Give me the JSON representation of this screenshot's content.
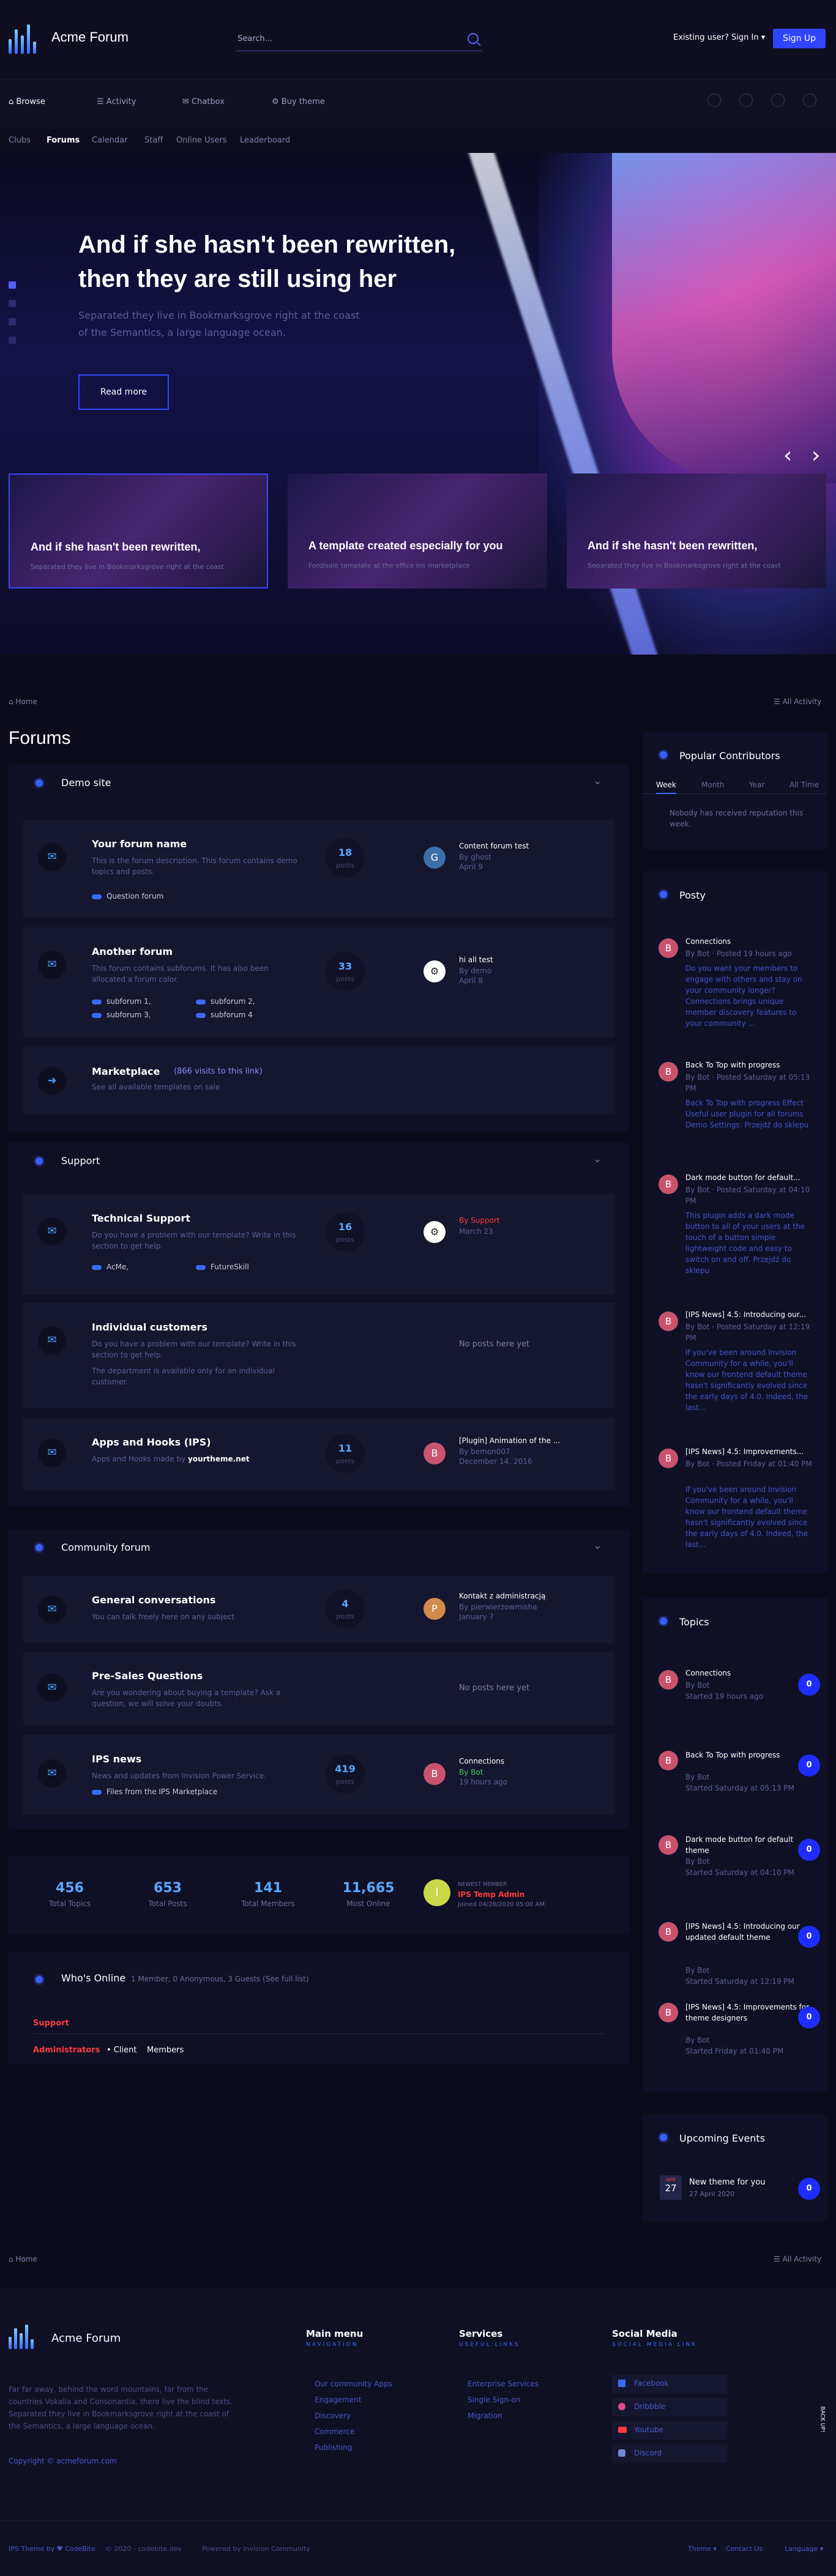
{
  "header": {
    "title": "Acme Forum",
    "search_placeholder": "Search...",
    "signin": "Existing user? Sign In ▾",
    "signup": "Sign Up"
  },
  "nav": {
    "items": [
      "Browse",
      "Activity",
      "Chatbox",
      "Buy theme"
    ]
  },
  "subnav": {
    "items": [
      "Clubs",
      "Forums",
      "Calendar",
      "Staff",
      "Online Users",
      "Leaderboard"
    ]
  },
  "hero": {
    "title": "And if she hasn't been rewritten, then they are still using her",
    "desc": "Separated they live in Bookmarksgrove right at the coast of the Semantics, a large language ocean.",
    "button": "Read more",
    "cards": [
      {
        "title": "And if she hasn't been rewritten,",
        "desc": "Separated they live in Bookmarksgrove right at the coast"
      },
      {
        "title": "A template created especially for you",
        "desc": "Fordisole template at the office ins marketplace"
      },
      {
        "title": "And if she hasn't been rewritten,",
        "desc": "Separated they live in Bookmarksgrove right at the coast"
      }
    ]
  },
  "breadcrumb": {
    "home": "Home",
    "all_activity": "All Activity"
  },
  "page_title": "Forums",
  "categories": [
    {
      "title": "Demo site",
      "forums": [
        {
          "name": "Your forum name",
          "desc": "This is the forum description. This forum contains demo topics and posts.",
          "sub": [
            "Question forum"
          ],
          "count": "18",
          "count_label": "posts",
          "av": "G",
          "av_color": "#3d6fa8",
          "lp_title": "Content forum test",
          "lp_by": "By ghost",
          "lp_date": "April 9"
        },
        {
          "name": "Another forum",
          "desc": "This forum contains subforums. It has also been allocated a forum color.",
          "sub": [
            "subforum 1,",
            "subforum 2,",
            "subforum 3,",
            "subforum 4"
          ],
          "count": "33",
          "count_label": "posts",
          "av": "⚙",
          "av_color": "#ffffff",
          "lp_title": "hi all test",
          "lp_by": "By demo",
          "lp_date": "April 8"
        },
        {
          "name": "Marketplace",
          "name_extra": "(866 visits to this link)",
          "desc": "See all available templates on sale"
        }
      ]
    },
    {
      "title": "Support",
      "forums": [
        {
          "name": "Technical Support",
          "desc": "Do you have a problem with our template? Write in this section to get help.",
          "sub": [
            "AcMe,",
            "FutureSkill"
          ],
          "count": "16",
          "count_label": "posts",
          "av": "⚙",
          "av_color": "#ffffff",
          "lp_title": "By Support",
          "lp_by": "",
          "lp_date": "March 23"
        },
        {
          "name": "Individual customers",
          "desc": "Do you have a problem with our template? Write in this section to get help.",
          "desc2": "The department is available only for an individual customer.",
          "nopost": "No posts here yet"
        },
        {
          "name": "Apps and Hooks (IPS)",
          "desc": "Apps and Hooks made by",
          "desc_link": "yourtheme.net",
          "count": "11",
          "count_label": "posts",
          "av": "B",
          "av_color": "#c8536e",
          "lp_title": "[Plugin] Animation of the ...",
          "lp_by": "By bemon007",
          "lp_date": "December 14, 2016"
        }
      ]
    },
    {
      "title": "Community forum",
      "forums": [
        {
          "name": "General conversations",
          "desc": "You can talk freely here on any subject",
          "count": "4",
          "count_label": "posts",
          "av": "P",
          "av_color": "#d08a4a",
          "lp_title": "Kontakt z administracją",
          "lp_by": "By pierwierzowmisha",
          "lp_date": "January 7"
        },
        {
          "name": "Pre-Sales Questions",
          "desc": "Are you wondering about buying a template? Ask a question, we will solve your doubts.",
          "nopost": "No posts here yet"
        },
        {
          "name": "IPS news",
          "desc": "News and updates from Invision Power Service.",
          "sub": [
            "Files from the IPS Marketplace"
          ],
          "count": "419",
          "count_label": "posts",
          "av": "B",
          "av_color": "#c8536e",
          "lp_title": "Connections",
          "lp_by": "By Bot",
          "lp_date": "19 hours ago"
        }
      ]
    }
  ],
  "stats": [
    {
      "n": "456",
      "l": "Total Topics"
    },
    {
      "n": "653",
      "l": "Total Posts"
    },
    {
      "n": "141",
      "l": "Total Members"
    },
    {
      "n": "11,665",
      "l": "Most Online"
    }
  ],
  "newest": {
    "label": "NEWEST MEMBER",
    "name": "IPS Temp Admin",
    "joined": "Joined 04/28/2020 05:00 AM",
    "av": "I"
  },
  "online": {
    "title": "Who's Online",
    "summary": "1 Member, 0 Anonymous, 3 Guests (See full list)",
    "member": "Support",
    "legend": [
      "Administrators",
      "• Client",
      "Members"
    ]
  },
  "sidebar": {
    "contributors": {
      "title": "Popular Contributors",
      "tabs": [
        "Week",
        "Month",
        "Year",
        "All Time"
      ],
      "empty": "Nobody has received reputation this week."
    },
    "posts": {
      "title": "Posty",
      "items": [
        {
          "t": "Connections",
          "m": "By Bot · Posted 19 hours ago",
          "b": "Do you want your members to engage with others and stay on your community longer? Connections brings unique member discovery features to your community ..."
        },
        {
          "t": "Back To Top with progress",
          "m": "By Bot · Posted Saturday at 05:13 PM",
          "b": "Back To Top with progress Effect Useful user plugin for all forums Demo Settings: Przejdź do sklepu"
        },
        {
          "t": "Dark mode button for default...",
          "m": "By Bot · Posted Saturday at 04:10 PM",
          "b": "This plugin adds a dark mode button to all of your users at the touch of a button simple lightweight code and easy to switch on and off. Przejdź do sklepu"
        },
        {
          "t": "[IPS News] 4.5: Introducing our...",
          "m": "By Bot · Posted Saturday at 12:19 PM",
          "b": "If you've been around Invision Community for a while, you'll know our frontend default theme hasn't significantly evolved since the early days of 4.0. Indeed, the last..."
        },
        {
          "t": "[IPS News] 4.5: Improvements...",
          "m": "By Bot · Posted Friday at 01:40 PM",
          "b": "If you've been around Invision Community for a while, you'll know our frontend default theme hasn't significantly evolved since the early days of 4.0. Indeed, the last..."
        }
      ]
    },
    "topics": {
      "title": "Topics",
      "items": [
        {
          "t": "Connections",
          "by": "By Bot",
          "s": "Started 19 hours ago",
          "c": "0"
        },
        {
          "t": "Back To Top with progress",
          "by": "By Bot",
          "s": "Started Saturday at 05:13 PM",
          "c": "0"
        },
        {
          "t": "Dark mode button for default theme",
          "by": "By Bot",
          "s": "Started Saturday at 04:10 PM",
          "c": "0"
        },
        {
          "t": "[IPS News] 4.5: Introducing our updated default theme",
          "by": "By Bot",
          "s": "Started Saturday at 12:19 PM",
          "c": "0"
        },
        {
          "t": "[IPS News] 4.5: Improvements for theme designers",
          "by": "By Bot",
          "s": "Started Friday at 01:40 PM",
          "c": "0"
        }
      ]
    },
    "events": {
      "title": "Upcoming Events",
      "month": "APR",
      "day": "27",
      "t": "New theme for you",
      "d": "27 April 2020",
      "c": "0"
    }
  },
  "footer": {
    "title": "Acme Forum",
    "about": "Far far away, behind the word mountains, far from the countries Vokalia and Consonantia, there live the blind texts. Separated they live in Bookmarksgrove right at the coast of the Semantics, a large language ocean.",
    "copyright": "Copyright © acmeforum.com",
    "main_menu": {
      "h": "Main menu",
      "s": "NAVIGATION",
      "items": [
        "Our community Apps",
        "Engagement",
        "Discovery",
        "Commerce",
        "Publishing"
      ]
    },
    "services": {
      "h": "Services",
      "s": "USEFUL LINKS",
      "items": [
        "Enterprise Services",
        "Single Sign-on",
        "Migration"
      ]
    },
    "social": {
      "h": "Social Media",
      "s": "SOCIAL MEDIA LINK",
      "items": [
        "Facebook",
        "Dribbble",
        "Youtube",
        "Discord"
      ]
    },
    "back_top": "BACK UP!",
    "bottom": {
      "theme": "IPS Theme by ♥ CodeBite",
      "year": "© 2020 - codebite.dev",
      "powered": "Powered by Invision Community",
      "links": [
        "Theme ▾",
        "Contact Us",
        "Language ▾"
      ]
    }
  }
}
